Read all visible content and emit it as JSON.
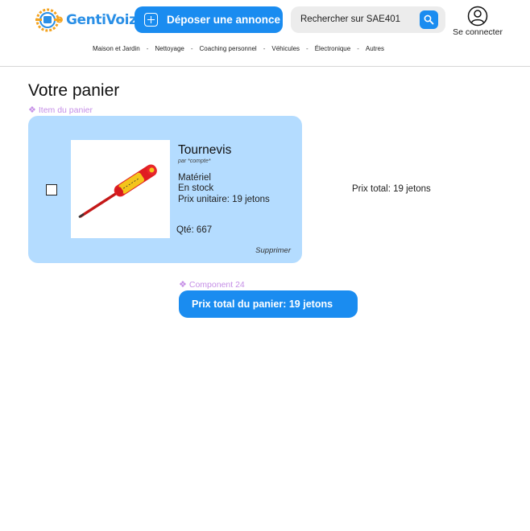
{
  "header": {
    "logo_text": "GentiVoizin",
    "post_button_label": "Déposer une annonce",
    "search_placeholder": "Rechercher sur SAE401",
    "login_label": "Se connecter"
  },
  "nav": {
    "items": [
      "Maison et Jardin",
      "Nettoyage",
      "Coaching personnel",
      "Véhicules",
      "Électronique",
      "Autres"
    ],
    "separator": "-"
  },
  "page_title": "Votre panier",
  "cart_item_label": "Item du panier",
  "cart_item": {
    "name": "Tournevis",
    "seller": "par *compte*",
    "category": "Matériel",
    "stock": "En stock",
    "unit_price": "Prix unitaire: 19 jetons",
    "quantity": "Qté: 667",
    "delete_label": "Supprimer",
    "line_total": "Prix total: 19 jetons"
  },
  "total_component_label": "Component 24",
  "cart_total_label": "Prix total du panier: 19 jetons",
  "colors": {
    "accent": "#1a8cf0",
    "card": "#b4dcff",
    "component_label": "#c58ee6"
  },
  "icons": [
    "logo-mark-icon",
    "plus-square-icon",
    "search-icon",
    "user-circle-icon",
    "diamond-component-icon",
    "screwdriver-image"
  ]
}
